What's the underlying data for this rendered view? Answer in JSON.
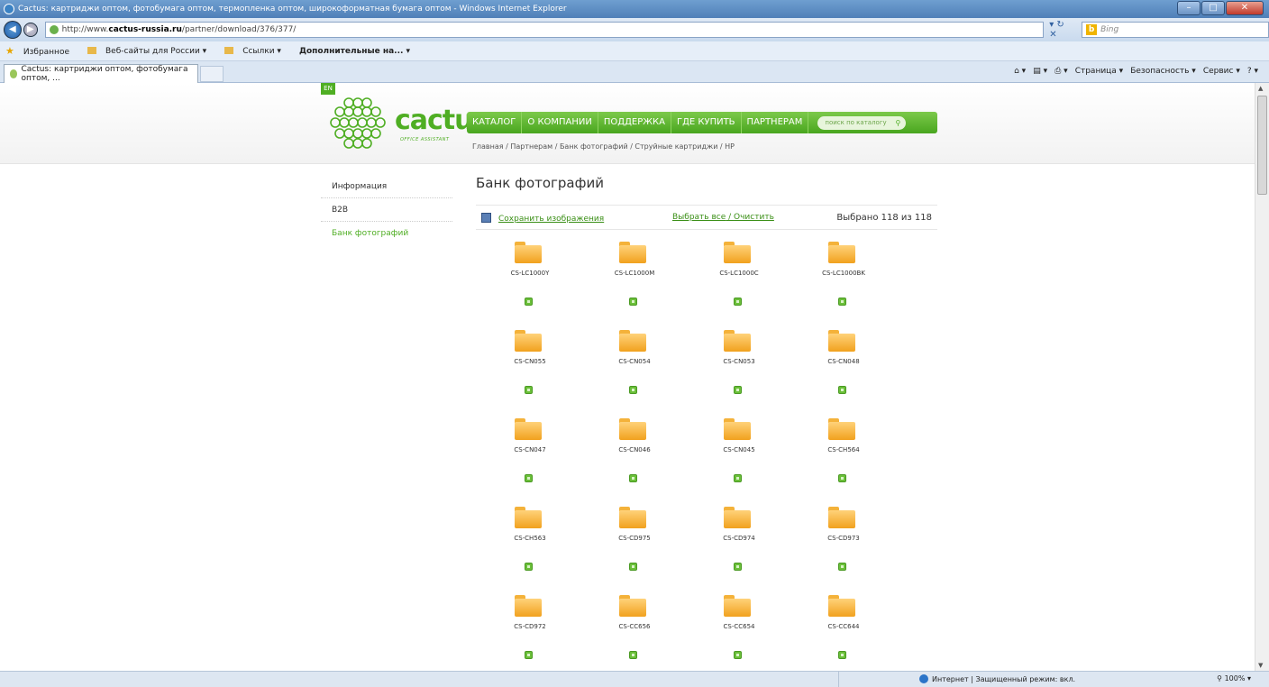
{
  "window": {
    "title": "Cactus: картриджи оптом, фотобумага оптом, термопленка оптом, широкоформатная бумага оптом - Windows Internet Explorer"
  },
  "address": {
    "url_prefix": "http://www.",
    "url_domain": "cactus-russia.ru",
    "url_path": "/partner/download/376/377/",
    "search_placeholder": "Bing"
  },
  "favorites": {
    "label": "Избранное",
    "items": [
      "Веб-сайты для России ▾",
      "Ссылки ▾",
      "Дополнительные на... ▾"
    ]
  },
  "tab": {
    "title": "Cactus: картриджи оптом, фотобумага оптом, ..."
  },
  "commands": [
    "Страница ▾",
    "Безопасность ▾",
    "Сервис ▾"
  ],
  "site": {
    "lang": "EN",
    "logo_text": "cactus",
    "logo_sub": "OFFICE ASSISTANT",
    "nav": [
      "КАТАЛОГ",
      "О КОМПАНИИ",
      "ПОДДЕРЖКА",
      "ГДЕ КУПИТЬ",
      "ПАРТНЕРАМ"
    ],
    "search_placeholder": "поиск по каталогу",
    "breadcrumb": "Главная / Партнерам / Банк фотографий / Струйные картриджи / HP",
    "sidebar": [
      "Информация",
      "B2B",
      "Банк фотографий"
    ],
    "page_title": "Банк фотографий",
    "save_label": "Сохранить изображения",
    "select_all": "Выбрать все",
    "clear": "Очистить",
    "selected_count": "Выбрано 118 из 118",
    "folders": [
      "CS-LC1000Y",
      "CS-LC1000M",
      "CS-LC1000C",
      "CS-LC1000BK",
      "CS-CN055",
      "CS-CN054",
      "CS-CN053",
      "CS-CN048",
      "CS-CN047",
      "CS-CN046",
      "CS-CN045",
      "CS-CH564",
      "CS-CH563",
      "CS-CD975",
      "CS-CD974",
      "CS-CD973",
      "CS-CD972",
      "CS-CC656",
      "CS-CC654",
      "CS-CC644"
    ]
  },
  "status": {
    "zone": "Интернет | Защищенный режим: вкл.",
    "zoom": "100%"
  }
}
